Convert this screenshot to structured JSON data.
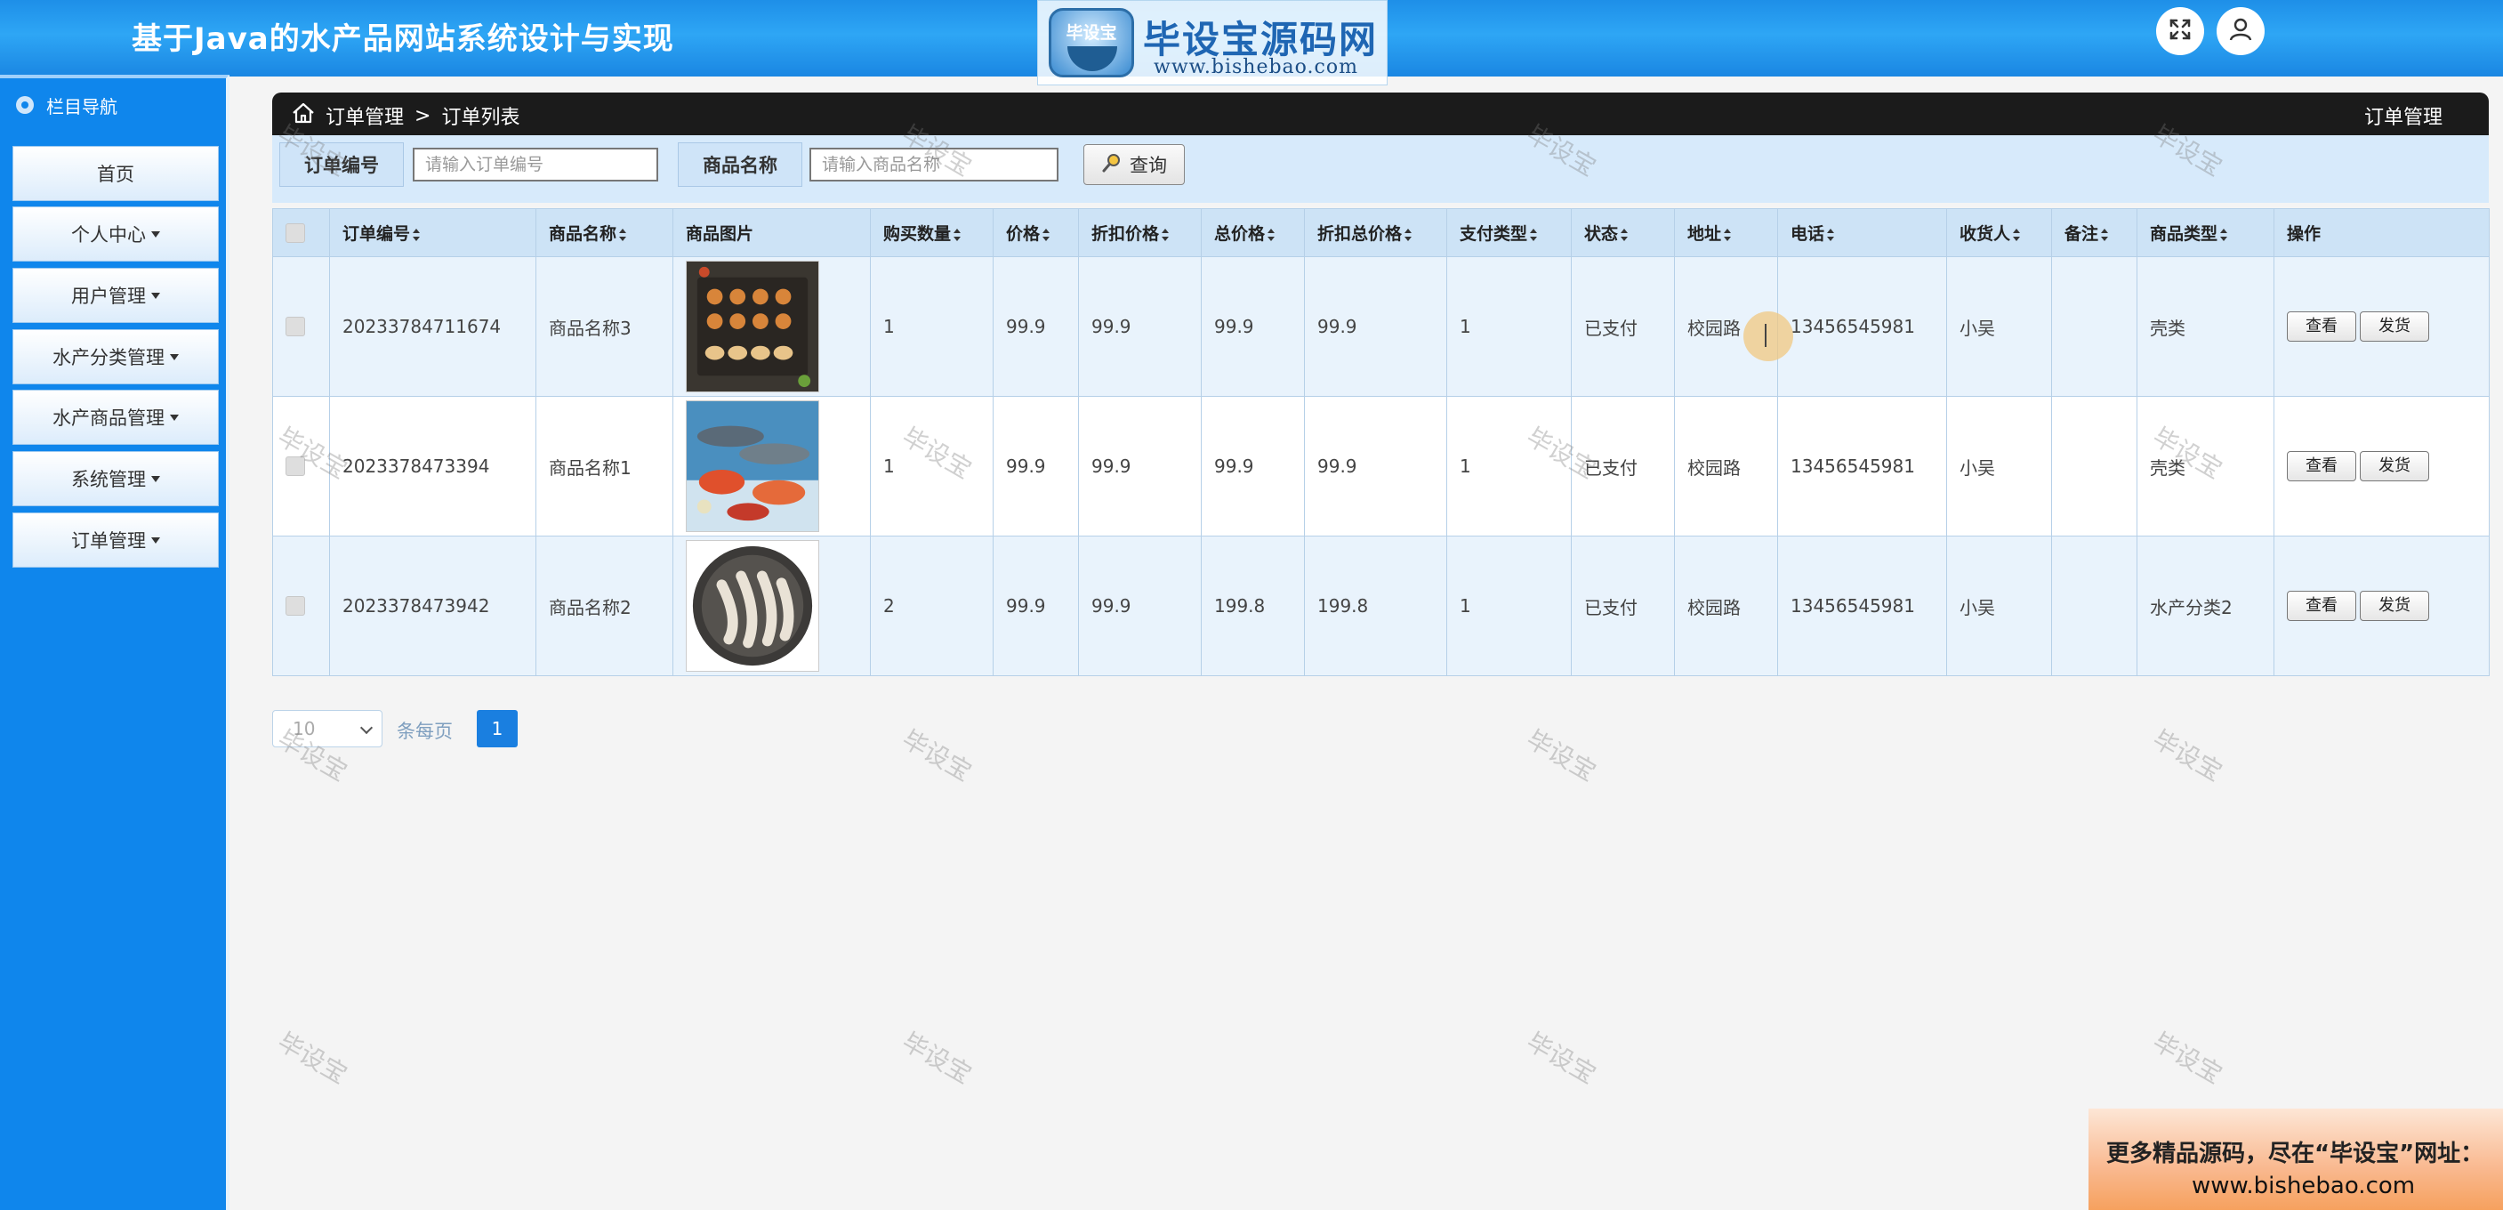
{
  "app_title": "基于Java的水产品网站系统设计与实现",
  "brand": {
    "badge_text": "毕设宝",
    "name": "毕设宝源码网",
    "url": "www.bishebao.com"
  },
  "header_icons": [
    "fullscreen-icon",
    "user-icon"
  ],
  "sidebar": {
    "heading": "栏目导航",
    "items": [
      {
        "label": "首页",
        "dropdown": false
      },
      {
        "label": "个人中心",
        "dropdown": true
      },
      {
        "label": "用户管理",
        "dropdown": true
      },
      {
        "label": "水产分类管理",
        "dropdown": true
      },
      {
        "label": "水产商品管理",
        "dropdown": true
      },
      {
        "label": "系统管理",
        "dropdown": true
      },
      {
        "label": "订单管理",
        "dropdown": true
      }
    ]
  },
  "breadcrumb": {
    "section": "订单管理",
    "separator": ">",
    "page": "订单列表",
    "right_title": "订单管理"
  },
  "search": {
    "order_no_label": "订单编号",
    "order_no_placeholder": "请输入订单编号",
    "product_name_label": "商品名称",
    "product_name_placeholder": "请输入商品名称",
    "query_button": "查询"
  },
  "table": {
    "columns": [
      "订单编号",
      "商品名称",
      "商品图片",
      "购买数量",
      "价格",
      "折扣价格",
      "总价格",
      "折扣总价格",
      "支付类型",
      "状态",
      "地址",
      "电话",
      "收货人",
      "备注",
      "商品类型",
      "操作"
    ],
    "rows": [
      {
        "order_no": "20233784711674",
        "product_name": "商品名称3",
        "image": "seafood-platter",
        "qty": "1",
        "price": "99.9",
        "discount_price": "99.9",
        "total": "99.9",
        "discount_total": "99.9",
        "pay_type": "1",
        "status": "已支付",
        "address": "校园路",
        "phone": "13456545981",
        "receiver": "小吴",
        "remark": "",
        "category": "壳类"
      },
      {
        "order_no": "2023378473394",
        "product_name": "商品名称1",
        "image": "fish-assortment",
        "qty": "1",
        "price": "99.9",
        "discount_price": "99.9",
        "total": "99.9",
        "discount_total": "99.9",
        "pay_type": "1",
        "status": "已支付",
        "address": "校园路",
        "phone": "13456545981",
        "receiver": "小吴",
        "remark": "",
        "category": "壳类"
      },
      {
        "order_no": "2023378473942",
        "product_name": "商品名称2",
        "image": "shrimp-plate",
        "qty": "2",
        "price": "99.9",
        "discount_price": "99.9",
        "total": "199.8",
        "discount_total": "199.8",
        "pay_type": "1",
        "status": "已支付",
        "address": "校园路",
        "phone": "13456545981",
        "receiver": "小吴",
        "remark": "",
        "category": "水产分类2"
      }
    ],
    "view_label": "查看",
    "ship_label": "发货"
  },
  "pagination": {
    "page_size": "10",
    "per_page_text": "条每页",
    "current_page": "1"
  },
  "watermark_text": "毕设宝",
  "promo": {
    "line1": "更多精品源码，尽在“毕设宝”网址：",
    "line2": "www.bishebao.com"
  },
  "colors": {
    "sidebar": "#0f86ec",
    "header": "#2ea6f5",
    "active_page": "#1a7fe0"
  }
}
